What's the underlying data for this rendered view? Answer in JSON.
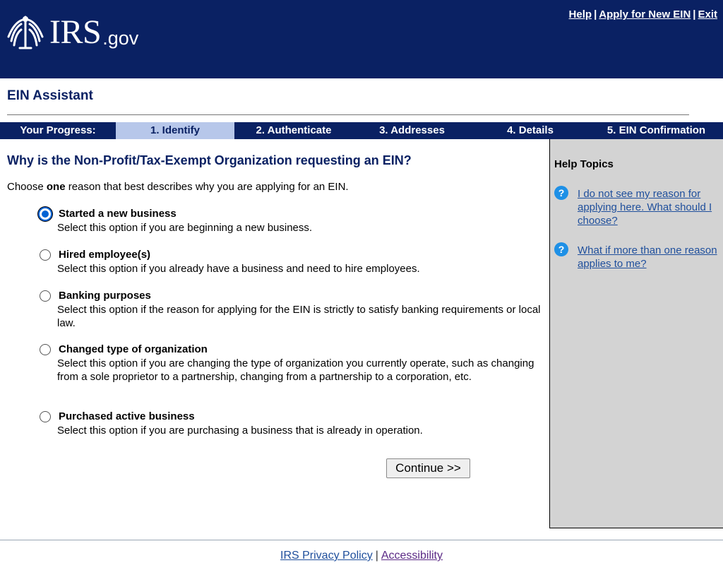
{
  "header": {
    "logo_irs": "IRS",
    "logo_gov": ".gov",
    "links": {
      "help": "Help",
      "apply": "Apply for New EIN",
      "exit": "Exit",
      "separator": "|"
    }
  },
  "app_title": "EIN Assistant",
  "progress": {
    "label": "Your Progress:",
    "steps": [
      "1. Identify",
      "2. Authenticate",
      "3. Addresses",
      "4. Details",
      "5. EIN Confirmation"
    ],
    "current_step": 1
  },
  "main": {
    "question": "Why is the Non-Profit/Tax-Exempt Organization requesting an EIN?",
    "instruction_pre": "Choose ",
    "instruction_bold": "one",
    "instruction_post": " reason that best describes why you are applying for an EIN.",
    "options": [
      {
        "title": "Started a new business",
        "description": "Select this option if you are beginning a new business.",
        "selected": true
      },
      {
        "title": "Hired employee(s)",
        "description": "Select this option if you already have a business and need to hire employees.",
        "selected": false
      },
      {
        "title": "Banking purposes",
        "description": "Select this option if the reason for applying for the EIN is strictly to satisfy banking requirements or local law.",
        "selected": false
      },
      {
        "title": "Changed type of organization",
        "description": "Select this option if you are changing the type of organization you currently operate, such as changing from a sole proprietor to a partnership, changing from a partnership to a corporation, etc.",
        "selected": false
      },
      {
        "title": "Purchased active business",
        "description": "Select this option if you are purchasing a business that is already in operation.",
        "selected": false
      }
    ],
    "continue_label": "Continue >>"
  },
  "help_panel": {
    "title": "Help Topics",
    "icon_glyph": "?",
    "items": [
      {
        "icon": "question-circle-icon",
        "link": "I do not see my reason for applying here. What should I choose?"
      },
      {
        "icon": "question-circle-icon",
        "link": "What if more than one reason applies to me?"
      }
    ]
  },
  "footer": {
    "privacy": "IRS Privacy Policy",
    "separator": "|",
    "accessibility": "Accessibility"
  },
  "colors": {
    "header_bg": "#0a2163",
    "active_step_bg": "#b7c7ea",
    "radio_selected": "#0063d3",
    "help_bg": "#d3d3d3",
    "link": "#1f4f9c"
  }
}
